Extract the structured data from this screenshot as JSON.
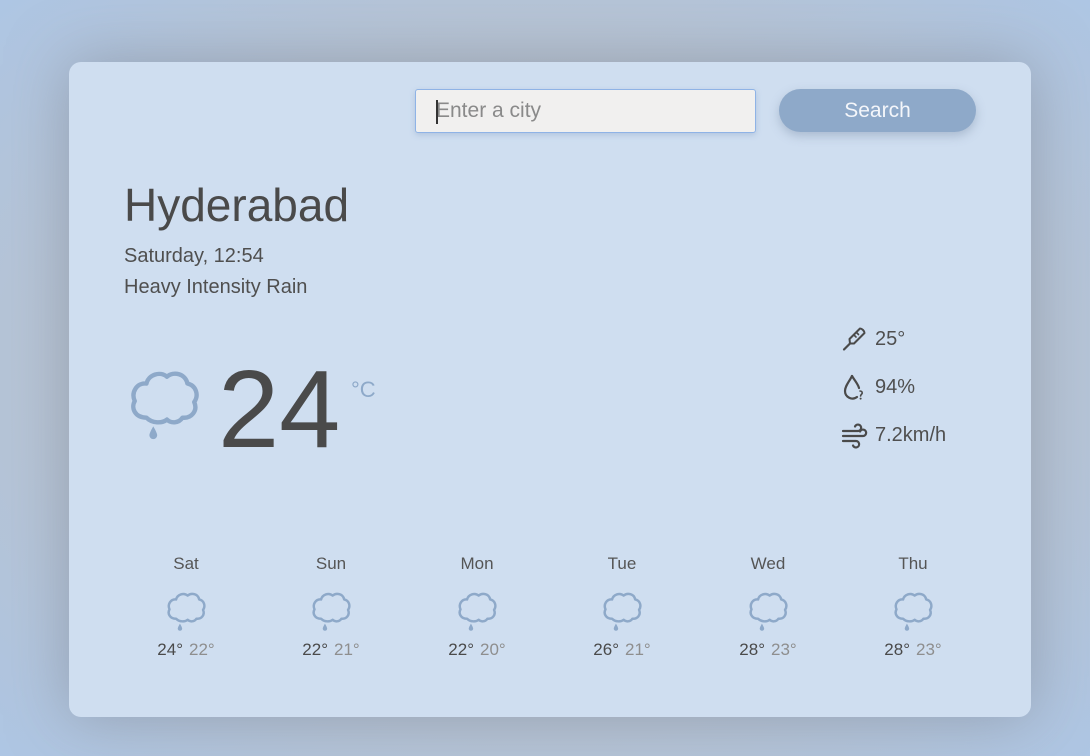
{
  "search": {
    "placeholder": "Enter a city",
    "value": "",
    "button_label": "Search"
  },
  "current": {
    "city": "Hyderabad",
    "datetime": "Saturday, 12:54",
    "condition": "Heavy Intensity Rain",
    "temperature": "24",
    "unit": "°C",
    "icon": "rain-cloud-icon"
  },
  "stats": {
    "feels_like": "25°",
    "humidity": "94%",
    "wind": "7.2km/h"
  },
  "forecast": [
    {
      "day": "Sat",
      "high": "24°",
      "low": "22°",
      "icon": "rain-cloud-icon"
    },
    {
      "day": "Sun",
      "high": "22°",
      "low": "21°",
      "icon": "rain-cloud-icon"
    },
    {
      "day": "Mon",
      "high": "22°",
      "low": "20°",
      "icon": "rain-cloud-icon"
    },
    {
      "day": "Tue",
      "high": "26°",
      "low": "21°",
      "icon": "rain-cloud-icon"
    },
    {
      "day": "Wed",
      "high": "28°",
      "low": "23°",
      "icon": "rain-cloud-icon"
    },
    {
      "day": "Thu",
      "high": "28°",
      "low": "23°",
      "icon": "rain-cloud-icon"
    }
  ],
  "colors": {
    "card_background": "#cfdef0",
    "accent": "#8ea9c9",
    "text": "#4a4a4a"
  }
}
